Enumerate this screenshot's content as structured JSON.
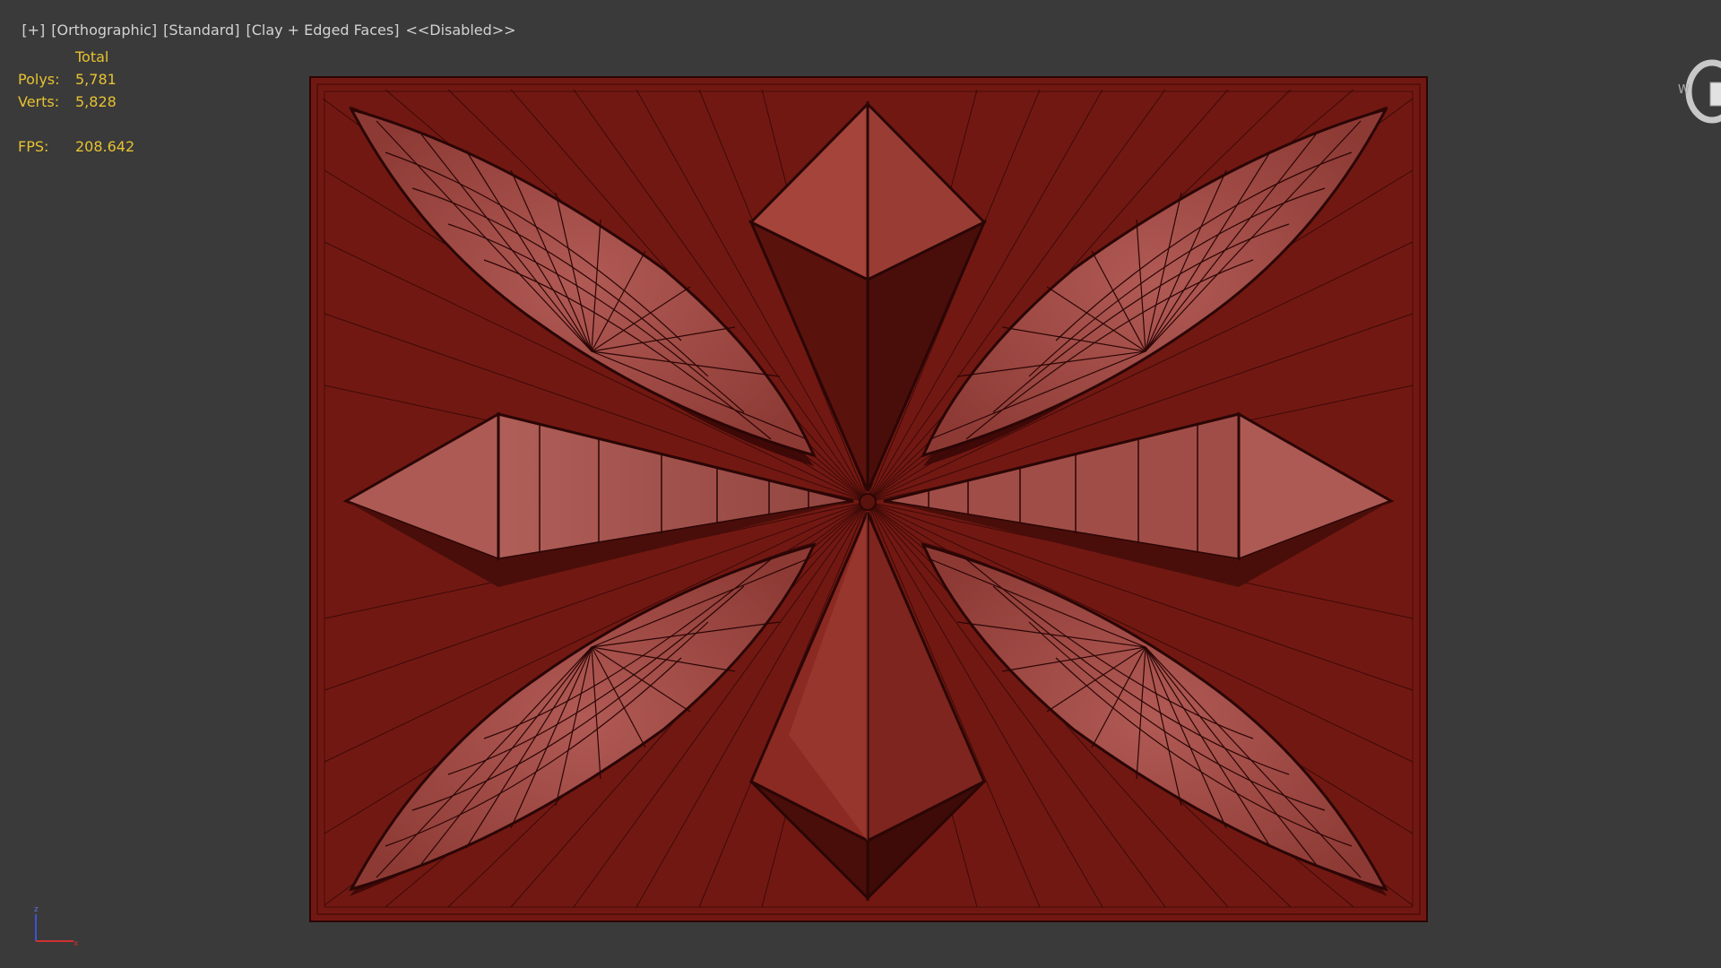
{
  "viewport_labels": {
    "plus": "[+]",
    "view": "[Orthographic]",
    "shading": "[Standard]",
    "display": "[Clay + Edged Faces]",
    "status": "<<Disabled>>"
  },
  "statistics": {
    "header": "Total",
    "polys_label": "Polys:",
    "polys_value": "5,781",
    "verts_label": "Verts:",
    "verts_value": "5,828",
    "fps_label": "FPS:",
    "fps_value": "208.642"
  },
  "viewcube": {
    "letter": "W"
  },
  "axis": {
    "z_label": "z",
    "x_label": "x"
  },
  "colors": {
    "background": "#3a3a3a",
    "panel_base": "#721812",
    "petal_face": "#a6504c",
    "diamond_face_light": "#a4443a",
    "diamond_face_dark": "#4a0e0a",
    "wire": "#2a0605",
    "stats_text": "#e7c232",
    "menu_text": "#d2d2d2"
  },
  "icons": [
    "viewcube-icon",
    "axis-tripod-icon"
  ]
}
